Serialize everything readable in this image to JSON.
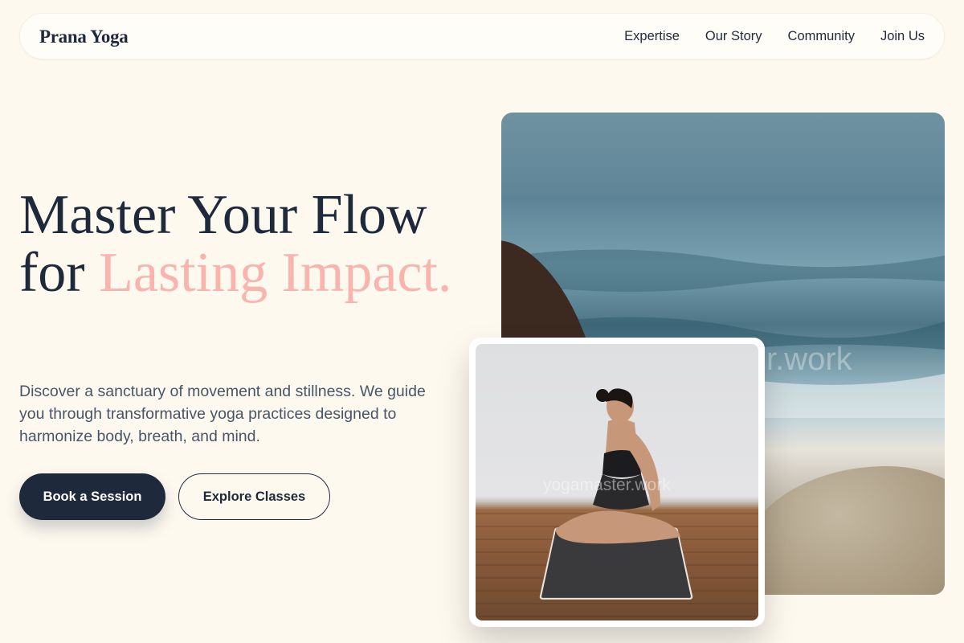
{
  "brand": {
    "name": "Prana Yoga"
  },
  "nav": {
    "items": [
      {
        "label": "Expertise"
      },
      {
        "label": "Our Story"
      },
      {
        "label": "Community"
      },
      {
        "label": "Join Us"
      }
    ]
  },
  "hero": {
    "title_line1": "Master Your Flow",
    "title_for": "for ",
    "title_accent": "Lasting Impact.",
    "description": "Discover a sanctuary of movement and stillness. We guide you through transformative yoga practices designed to harmonize body, breath, and mind.",
    "primary_button": "Book a Session",
    "secondary_button": "Explore Classes"
  },
  "images": {
    "main_watermark": "r.work",
    "card_watermark": "yogamaster.work"
  },
  "colors": {
    "background": "#fdf9ef",
    "primary": "#1e293b",
    "accent": "#f8b4ad",
    "text_muted": "#475569"
  }
}
